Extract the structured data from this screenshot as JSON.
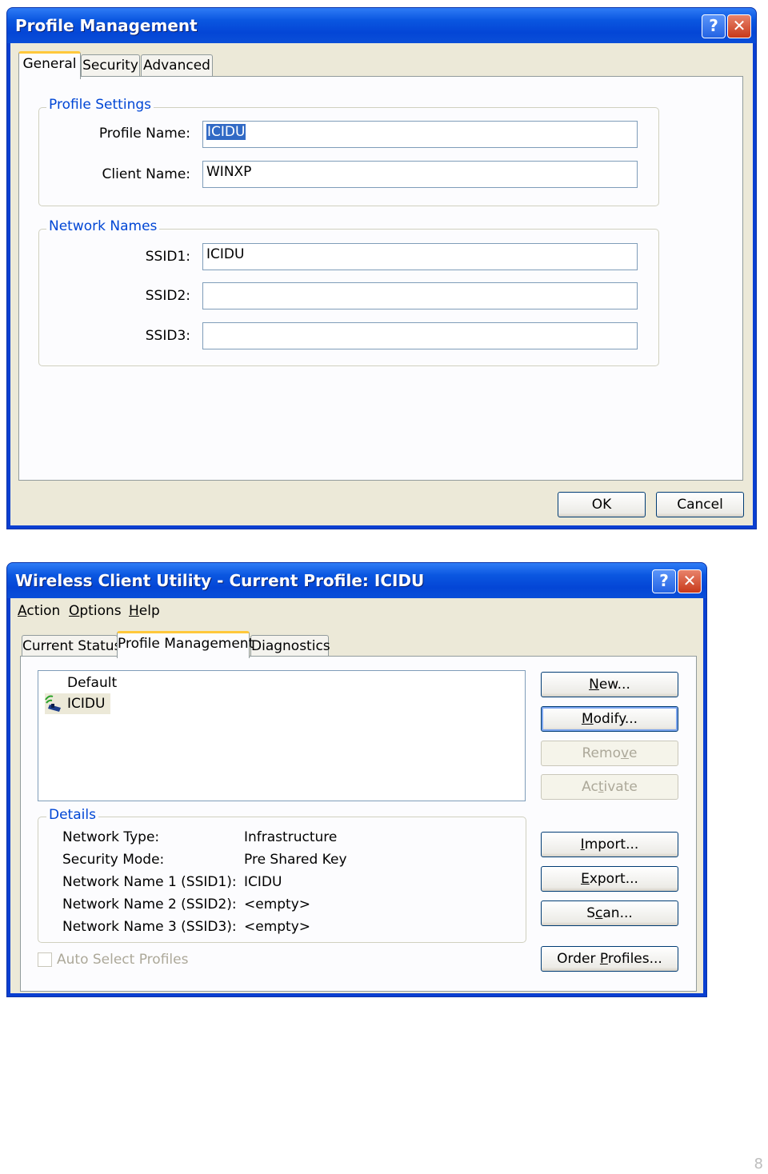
{
  "dialog1": {
    "title": "Profile Management",
    "tabs": [
      "General",
      "Security",
      "Advanced"
    ],
    "profile_settings": {
      "legend": "Profile Settings",
      "profile_name_label": "Profile Name:",
      "profile_name_value": "ICIDU",
      "client_name_label": "Client Name:",
      "client_name_value": "WINXP"
    },
    "network_names": {
      "legend": "Network Names",
      "ssid1_label": "SSID1:",
      "ssid1_value": "ICIDU",
      "ssid2_label": "SSID2:",
      "ssid2_value": "",
      "ssid3_label": "SSID3:",
      "ssid3_value": ""
    },
    "ok_label": "OK",
    "cancel_label": "Cancel"
  },
  "dialog2": {
    "title": "Wireless Client Utility - Current Profile: ICIDU",
    "menu": [
      "Action",
      "Options",
      "Help"
    ],
    "tabs": [
      "Current Status",
      "Profile Management",
      "Diagnostics"
    ],
    "profiles": [
      "Default",
      "ICIDU"
    ],
    "buttons": {
      "new": "New...",
      "modify": "Modify...",
      "remove": "Remove",
      "activate": "Activate",
      "import": "Import...",
      "export": "Export...",
      "scan": "Scan...",
      "order": "Order Profiles..."
    },
    "details": {
      "legend": "Details",
      "rows": [
        {
          "label": "Network Type:",
          "value": "Infrastructure"
        },
        {
          "label": "Security Mode:",
          "value": "Pre Shared Key"
        },
        {
          "label": "Network Name 1 (SSID1):",
          "value": "ICIDU"
        },
        {
          "label": "Network Name 2 (SSID2):",
          "value": "<empty>"
        },
        {
          "label": "Network Name 3 (SSID3):",
          "value": "<empty>"
        }
      ]
    },
    "auto_select_label": "Auto Select Profiles"
  },
  "page_number": "8"
}
